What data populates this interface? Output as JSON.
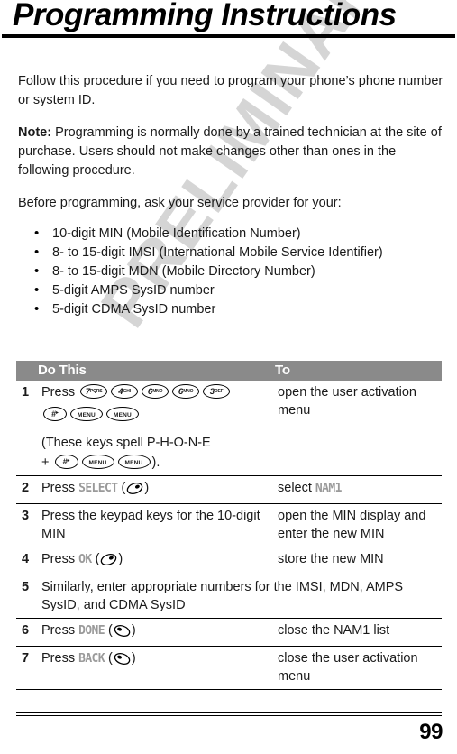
{
  "document": {
    "title": "Programming Instructions",
    "page_number": "99",
    "watermark": "PRELIMINARY"
  },
  "body": {
    "paragraph_1": "Follow this procedure if you need to program your phone’s phone number or system ID.",
    "note_label": "Note:",
    "paragraph_2": " Programming is normally done by a trained technician at the site of purchase. Users should not make changes other than ones in the following procedure.",
    "paragraph_3": "Before programming, ask your service provider for your:",
    "bullets": [
      "10-digit MIN (Mobile Identification Number)",
      "8- to 15-digit IMSI (International Mobile Service Identifier)",
      "8- to 15-digit MDN (Mobile Directory Number)",
      "5-digit AMPS SysID number",
      "5-digit CDMA SysID number"
    ]
  },
  "table": {
    "headers": {
      "number": "",
      "do_this": "Do This",
      "to": "To"
    },
    "rows": [
      {
        "number": "1",
        "do_this_prefix": "Press ",
        "keys": [
          {
            "digit": "7",
            "letters": "PQRS"
          },
          {
            "digit": "4",
            "letters": "GHI"
          },
          {
            "digit": "6",
            "letters": "MNO"
          },
          {
            "digit": "6",
            "letters": "MNO"
          },
          {
            "digit": "3",
            "letters": "DEF"
          }
        ],
        "keys_row2": [
          {
            "digit": "#",
            "letters": "▸"
          },
          {
            "label": "MENU"
          },
          {
            "label": "MENU"
          }
        ],
        "note_open": "(These keys spell P-H-O-N-E",
        "note_plus": "+ ",
        "note_close": ").",
        "to": "open the user activation menu"
      },
      {
        "number": "2",
        "do_this_prefix": "Press ",
        "display_label": "SELECT",
        "softkey": "right",
        "to_prefix": "select ",
        "to_display": "NAM1"
      },
      {
        "number": "3",
        "do_this": "Press the keypad keys for the 10-digit MIN",
        "to": "open the MIN display and enter the new MIN"
      },
      {
        "number": "4",
        "do_this_prefix": "Press ",
        "display_label": "OK",
        "softkey": "right",
        "to": "store the new MIN"
      },
      {
        "number": "5",
        "span": "Similarly, enter appropriate numbers for the IMSI, MDN, AMPS SysID, and CDMA SysID"
      },
      {
        "number": "6",
        "do_this_prefix": "Press ",
        "display_label": "DONE",
        "softkey": "left",
        "to": "close the NAM1 list"
      },
      {
        "number": "7",
        "do_this_prefix": "Press ",
        "display_label": "BACK",
        "softkey": "left",
        "to": "close the user activation menu"
      }
    ]
  },
  "colors": {
    "header_band": "#8a8a8a",
    "display_text": "#9a9a9a",
    "watermark": "#d5d5d5",
    "rule": "#000000"
  }
}
